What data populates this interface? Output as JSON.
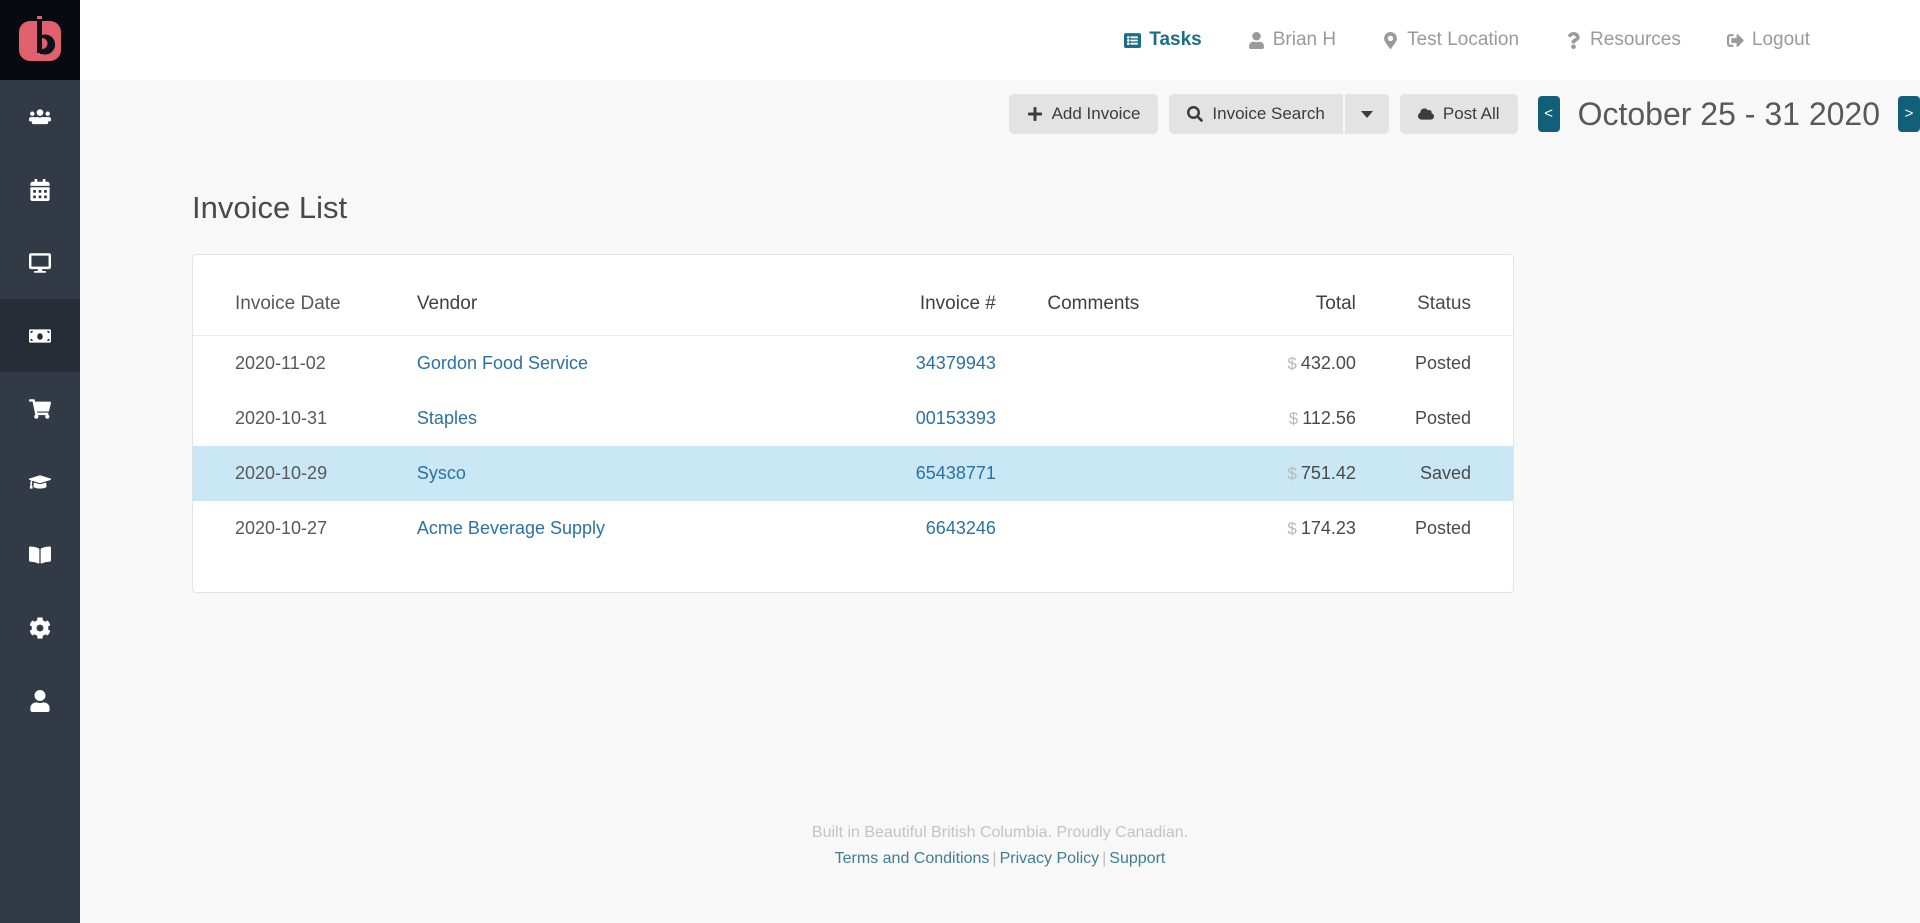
{
  "brand": {
    "logo_name": "b-logo",
    "logo_color": "#e0606e",
    "logo_bg": "#070a10"
  },
  "colors": {
    "sidebar_bg": "#323a45",
    "sidebar_active_bg": "#262d37",
    "accent_teal": "#1b6e87",
    "date_button": "#116077",
    "link_blue": "#2a72a4",
    "row_highlight": "#c9e7f4"
  },
  "sidebar": {
    "items": [
      {
        "icon": "users-icon",
        "active": false
      },
      {
        "icon": "calendar-icon",
        "active": false
      },
      {
        "icon": "desktop-icon",
        "active": false
      },
      {
        "icon": "money-bill-icon",
        "active": true
      },
      {
        "icon": "shopping-cart-icon",
        "active": false
      },
      {
        "icon": "graduation-cap-icon",
        "active": false
      },
      {
        "icon": "book-icon",
        "active": false
      },
      {
        "icon": "gear-icon",
        "active": false
      },
      {
        "icon": "user-icon",
        "active": false
      }
    ]
  },
  "topnav": {
    "links": [
      {
        "label": "Tasks",
        "icon": "list-alt-icon",
        "active": true
      },
      {
        "label": "Brian H",
        "icon": "user-icon",
        "active": false
      },
      {
        "label": "Test Location",
        "icon": "map-pin-icon",
        "active": false
      },
      {
        "label": "Resources",
        "icon": "question-icon",
        "active": false
      },
      {
        "label": "Logout",
        "icon": "sign-out-icon",
        "active": false
      }
    ]
  },
  "toolbar": {
    "add_invoice_label": "Add Invoice",
    "invoice_search_label": "Invoice Search",
    "post_all_label": "Post All",
    "prev_label": "<",
    "next_label": ">",
    "date_range": "October 25 - 31 2020"
  },
  "main": {
    "page_title": "Invoice List",
    "table": {
      "columns": [
        "Invoice Date",
        "Vendor",
        "Invoice #",
        "Comments",
        "Total",
        "Status"
      ],
      "rows": [
        {
          "date": "2020-11-02",
          "vendor": "Gordon Food Service",
          "invoice": "34379943",
          "comments": "",
          "currency": "$",
          "total": "432.00",
          "status": "Posted",
          "highlight": false
        },
        {
          "date": "2020-10-31",
          "vendor": "Staples",
          "invoice": "00153393",
          "comments": "",
          "currency": "$",
          "total": "112.56",
          "status": "Posted",
          "highlight": false
        },
        {
          "date": "2020-10-29",
          "vendor": "Sysco",
          "invoice": "65438771",
          "comments": "",
          "currency": "$",
          "total": "751.42",
          "status": "Saved",
          "highlight": true
        },
        {
          "date": "2020-10-27",
          "vendor": "Acme Beverage Supply",
          "invoice": "6643246",
          "comments": "",
          "currency": "$",
          "total": "174.23",
          "status": "Posted",
          "highlight": false
        }
      ]
    }
  },
  "footer": {
    "note": "Built in Beautiful British Columbia. Proudly Canadian.",
    "links": [
      {
        "label": "Terms and Conditions"
      },
      {
        "label": "Privacy Policy"
      },
      {
        "label": "Support"
      }
    ],
    "separator": "|"
  }
}
